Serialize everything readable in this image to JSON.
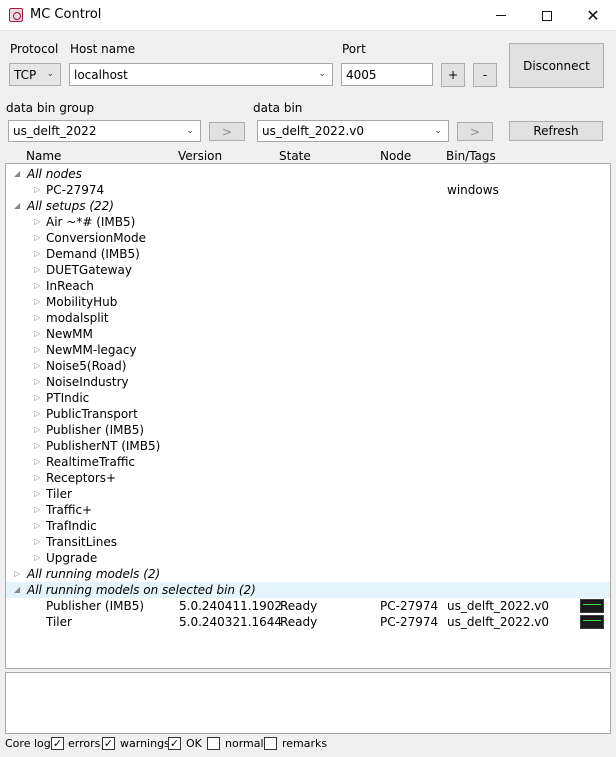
{
  "window": {
    "title": "MC Control"
  },
  "connection": {
    "protocol_label": "Protocol",
    "protocol_value": "TCP",
    "host_label": "Host name",
    "host_value": "localhost",
    "port_label": "Port",
    "port_value": "4005",
    "plus_label": "+",
    "minus_label": "-",
    "disconnect_label": "Disconnect"
  },
  "bins": {
    "group_label": "data bin group",
    "group_value": "us_delft_2022",
    "group_go_label": ">",
    "bin_label": "data bin",
    "bin_value": "us_delft_2022.v0",
    "bin_go_label": ">",
    "refresh_label": "Refresh"
  },
  "columns": {
    "name": "Name",
    "version": "Version",
    "state": "State",
    "node": "Node",
    "bin_tags": "Bin/Tags"
  },
  "tree": {
    "all_nodes": "All nodes",
    "node_name": "PC-27974",
    "node_tags": "windows",
    "all_setups": "All setups (22)",
    "setups": [
      "Air ~*# (IMB5)",
      "ConversionMode",
      "Demand (IMB5)",
      "DUETGateway",
      "InReach",
      "MobilityHub",
      "modalsplit",
      "NewMM",
      "NewMM-legacy",
      "Noise5(Road)",
      "NoiseIndustry",
      "PTIndic",
      "PublicTransport",
      "Publisher (IMB5)",
      "PublisherNT (IMB5)",
      "RealtimeTraffic",
      "Receptors+",
      "Tiler",
      "Traffic+",
      "TrafIndic",
      "TransitLines",
      "Upgrade"
    ],
    "all_running": "All running models (2)",
    "running_on_bin": "All running models on selected bin (2)",
    "models": [
      {
        "name": "Publisher (IMB5)",
        "version": "5.0.240411.1902",
        "state": "Ready",
        "node": "PC-27974",
        "bin": "us_delft_2022.v0"
      },
      {
        "name": "Tiler",
        "version": "5.0.240321.1644",
        "state": "Ready",
        "node": "PC-27974",
        "bin": "us_delft_2022.v0"
      }
    ]
  },
  "footer": {
    "core_log": "Core log",
    "errors": "errors",
    "warnings": "warnings",
    "ok": "OK",
    "normal": "normal",
    "remarks": "remarks",
    "errors_checked": true,
    "warnings_checked": true,
    "ok_checked": true,
    "normal_checked": false,
    "remarks_checked": false
  }
}
